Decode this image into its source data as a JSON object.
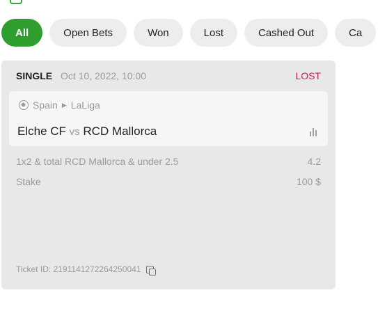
{
  "filters": [
    {
      "label": "All",
      "active": true
    },
    {
      "label": "Open Bets",
      "active": false
    },
    {
      "label": "Won",
      "active": false
    },
    {
      "label": "Lost",
      "active": false
    },
    {
      "label": "Cashed Out",
      "active": false
    },
    {
      "label": "Ca",
      "active": false
    }
  ],
  "bet": {
    "type": "SINGLE",
    "date": "Oct 10, 2022, 10:00",
    "status": "LOST",
    "status_color": "#e0114f",
    "event": {
      "country": "Spain",
      "league": "LaLiga",
      "home": "Elche CF",
      "vs": "vs",
      "away": "RCD Mallorca"
    },
    "selection": "1x2 & total RCD Mallorca & under 2.5",
    "odds": "4.2",
    "stake_label": "Stake",
    "stake_value": "100 $",
    "ticket": "Ticket ID: 2191141272264250041"
  },
  "colors": {
    "accent": "#2f9e2f",
    "chip_bg": "#ededed",
    "card_bg": "#e8e8e8"
  }
}
